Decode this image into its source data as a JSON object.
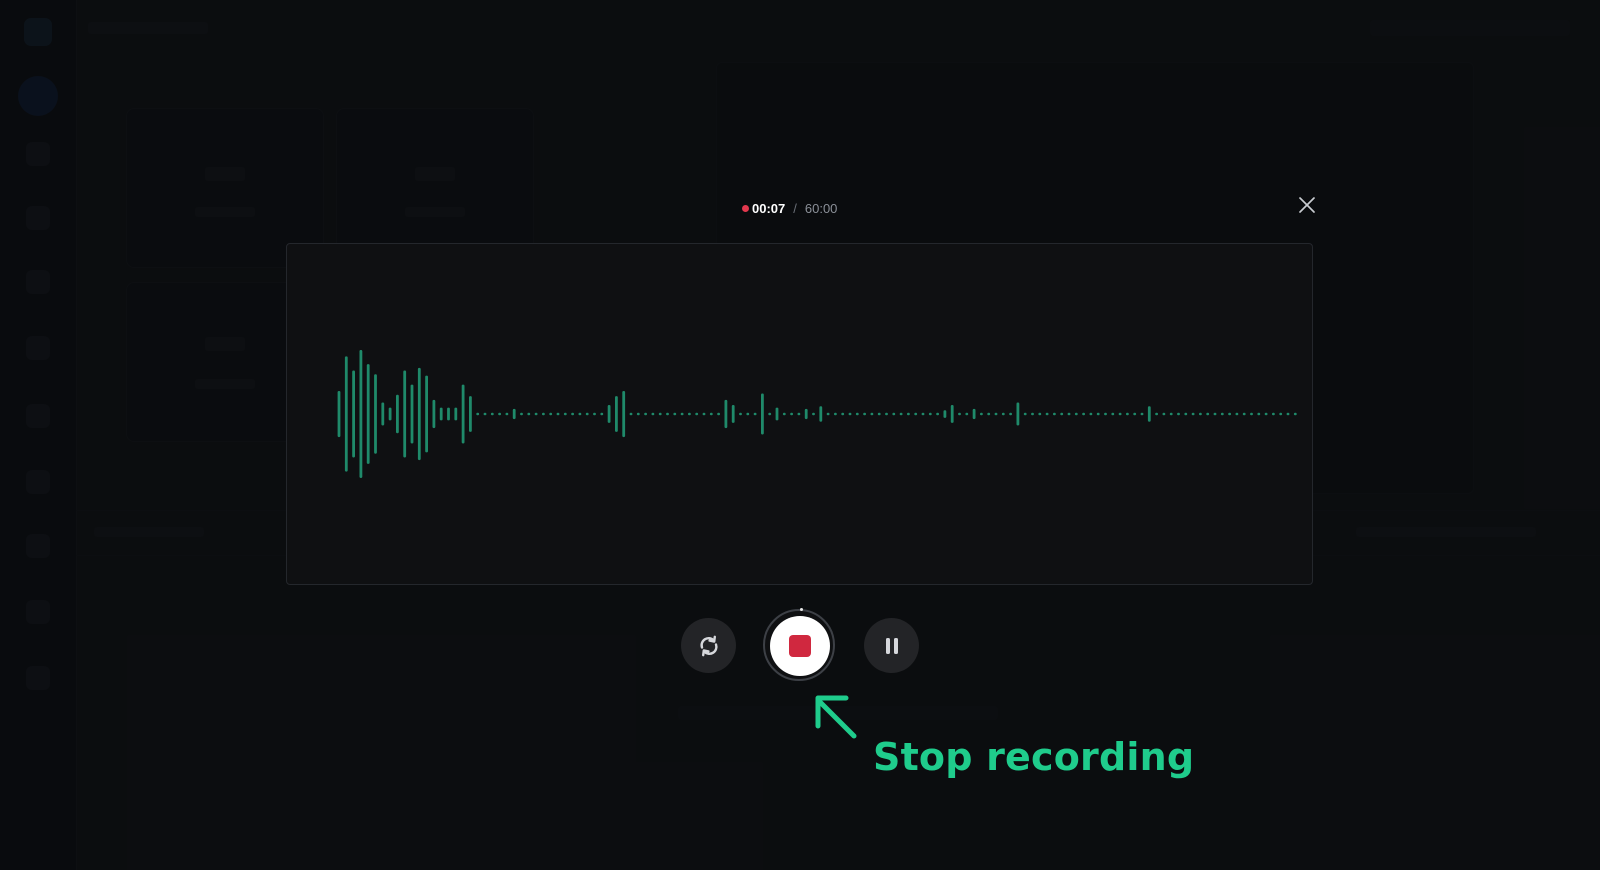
{
  "recorder": {
    "elapsed": "00:07",
    "separator": "/",
    "total": "60:00",
    "recording_color": "#e2384d",
    "waveform_color": "#1f8a6a",
    "waveform_amplitudes": [
      0.36,
      0.9,
      0.68,
      1.0,
      0.78,
      0.62,
      0.18,
      0.1,
      0.3,
      0.68,
      0.46,
      0.72,
      0.6,
      0.22,
      0.1,
      0.1,
      0.1,
      0.46,
      0.28,
      0.02,
      0.02,
      0.02,
      0.02,
      0.02,
      0.08,
      0.02,
      0.02,
      0.02,
      0.02,
      0.02,
      0.02,
      0.02,
      0.02,
      0.02,
      0.02,
      0.02,
      0.02,
      0.14,
      0.28,
      0.36,
      0.02,
      0.02,
      0.02,
      0.02,
      0.02,
      0.02,
      0.02,
      0.02,
      0.02,
      0.02,
      0.02,
      0.02,
      0.02,
      0.22,
      0.14,
      0.02,
      0.02,
      0.02,
      0.32,
      0.02,
      0.1,
      0.02,
      0.02,
      0.02,
      0.08,
      0.02,
      0.12,
      0.02,
      0.02,
      0.02,
      0.02,
      0.02,
      0.02,
      0.02,
      0.02,
      0.02,
      0.02,
      0.02,
      0.02,
      0.02,
      0.02,
      0.02,
      0.02,
      0.06,
      0.14,
      0.02,
      0.02,
      0.08,
      0.02,
      0.02,
      0.02,
      0.02,
      0.02,
      0.18,
      0.02,
      0.02,
      0.02,
      0.02,
      0.02,
      0.02,
      0.02,
      0.02,
      0.02,
      0.02,
      0.02,
      0.02,
      0.02,
      0.02,
      0.02,
      0.02,
      0.02,
      0.12,
      0.02,
      0.02,
      0.02,
      0.02,
      0.02,
      0.02,
      0.02,
      0.02,
      0.02,
      0.02,
      0.02,
      0.02,
      0.02,
      0.02,
      0.02,
      0.02,
      0.02,
      0.02,
      0.02,
      0.02
    ]
  },
  "controls": {
    "restart_icon": "restart-icon",
    "stop_icon": "stop-icon",
    "pause_icon": "pause-icon",
    "close_icon": "close-icon"
  },
  "annotation": {
    "text": "Stop recording",
    "color": "#1fcc8c",
    "arrow_icon": "arrow-up-left-icon"
  }
}
